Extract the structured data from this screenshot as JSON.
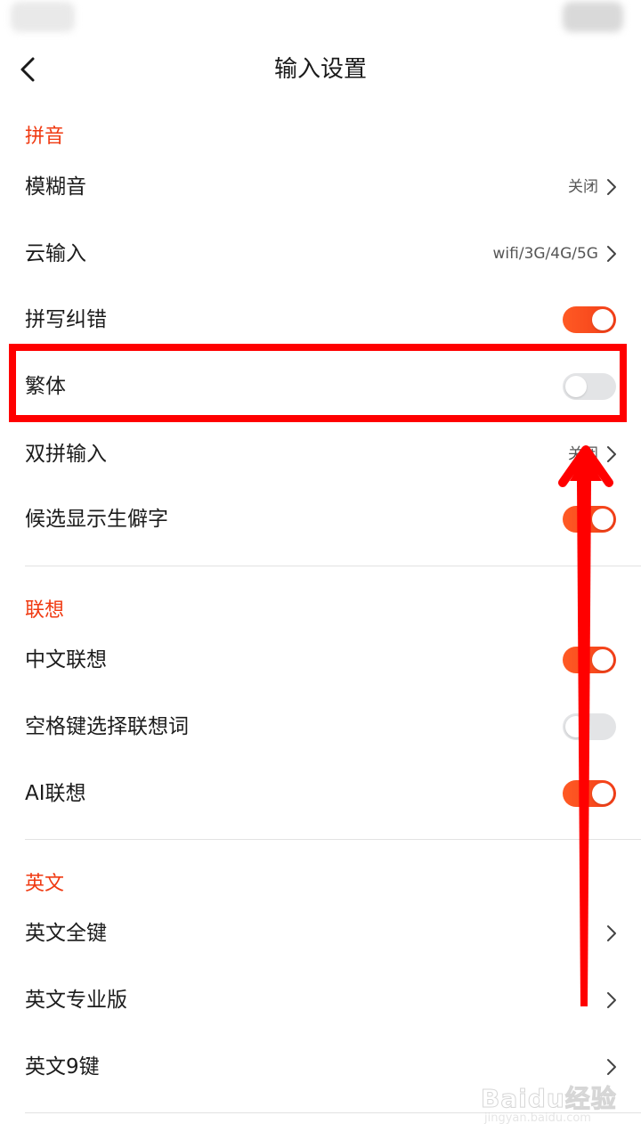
{
  "header": {
    "title": "输入设置",
    "back_icon": "chevron-left-icon"
  },
  "sections": {
    "pinyin": {
      "title": "拼音",
      "items": [
        {
          "label": "模糊音",
          "value": "关闭",
          "control": "chevron"
        },
        {
          "label": "云输入",
          "value": "wifi/3G/4G/5G",
          "control": "chevron"
        },
        {
          "label": "拼写纠错",
          "control": "toggle",
          "state": "on"
        },
        {
          "label": "繁体",
          "control": "toggle",
          "state": "off"
        },
        {
          "label": "双拼输入",
          "value": "关闭",
          "control": "chevron"
        },
        {
          "label": "候选显示生僻字",
          "control": "toggle",
          "state": "on"
        }
      ]
    },
    "association": {
      "title": "联想",
      "items": [
        {
          "label": "中文联想",
          "control": "toggle",
          "state": "on"
        },
        {
          "label": "空格键选择联想词",
          "control": "toggle",
          "state": "off"
        },
        {
          "label": "AI联想",
          "control": "toggle",
          "state": "on"
        }
      ]
    },
    "english": {
      "title": "英文",
      "items": [
        {
          "label": "英文全键",
          "control": "chevron"
        },
        {
          "label": "英文专业版",
          "control": "chevron"
        },
        {
          "label": "英文9键",
          "control": "chevron"
        }
      ]
    }
  },
  "annotation": {
    "highlight_color": "#ff0000",
    "arrow_color": "#ff0000"
  },
  "colors": {
    "accent": "#f23e18",
    "section_title": "#f03a12",
    "toggle_off": "#e3e4e6"
  },
  "watermark": {
    "logo": "Baidu经验",
    "url": "jingyan.baidu.com"
  }
}
